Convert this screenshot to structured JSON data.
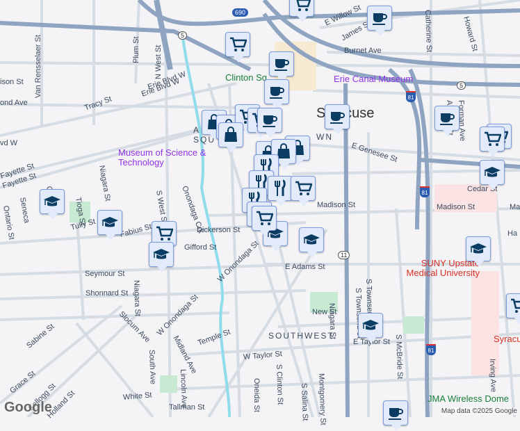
{
  "map": {
    "streets": [
      "Van Rensselaer St",
      "Plum St",
      "N West St",
      "Tracy St",
      "Erie Blvd W",
      "Fayette St",
      "Tioga St",
      "Niagara St",
      "S West St",
      "Seneca",
      "Osw",
      "Ontario St",
      "Tully St",
      "Fabius St",
      "Dickerson St",
      "Gifford St",
      "Seymour St",
      "Shonnard St",
      "Slocum Ave",
      "W Onondaga St",
      "W Onondaga St",
      "Sabine St",
      "Grace St",
      "Kellogg St",
      "Holland St",
      "South Ave",
      "Midland Ave",
      "Lincoln Ave",
      "Temple St",
      "W Taylor St",
      "White St",
      "Tallman St",
      "Oneida St",
      "S Clinton St",
      "S Salina St",
      "Montgomery St",
      "E Adams St",
      "New St",
      "E Taylor St",
      "S Townsend St",
      "S McBride St",
      "Irving Ave",
      "Madison St",
      "Madison St",
      "Cedar St",
      "E Genesee St",
      "Almond St",
      "Forman Ave",
      "Burnet Ave",
      "James St",
      "E Willow St",
      "Catherine St",
      "Howard St",
      "Erie Blvd W",
      "Fayette St",
      "ison St",
      "ond Ave",
      "vd W",
      "Niagara St",
      "Onondaga Crk",
      "Niagara St",
      "Ha",
      "Ma",
      "S Townsend St"
    ],
    "places": {
      "museum_science": "Museum of Science & Technology",
      "erie_canal": "Erie Canal Museum",
      "clinton_sq": "Clinton Sq",
      "suny": "SUNY Upstate Medical University",
      "syracuse_hosp": "Syracu",
      "jma": "JMA Wireless Dome",
      "city": "Syracuse",
      "southwest": "SOUTHWEST",
      "armory": "A SQU",
      "downtown": "WN"
    },
    "shields": {
      "i690": "690",
      "rt5a": "5",
      "rt5b": "5",
      "i81a": "81",
      "i81b": "81",
      "i81c": "81",
      "us11": "11"
    },
    "markers": [
      "shopping-cart",
      "coffee-cup",
      "shopping-cart",
      "coffee-cup",
      "coffee-cup",
      "coffee-cup",
      "coffee-cup",
      "shopping-cart",
      "shopping-cart",
      "graduation-cap",
      "graduation-cap",
      "graduation-cap",
      "shopping-cart",
      "graduation-cap",
      "graduation-cap",
      "graduation-cap",
      "graduation-cap",
      "shopping-cart",
      "graduation-cap",
      "coffee-cup",
      "shopping-bag",
      "shopping-bag",
      "shopping-cart",
      "shopping-cart",
      "coffee-cup",
      "shopping-bag",
      "shopping-bag",
      "shopping-bag",
      "shopping-bag",
      "restaurant",
      "restaurant",
      "restaurant",
      "shopping-cart",
      "restaurant",
      "shopping-cart",
      "shopping-cart"
    ],
    "google_logo": "Google",
    "attribution": "Map data ©2025 Google"
  }
}
